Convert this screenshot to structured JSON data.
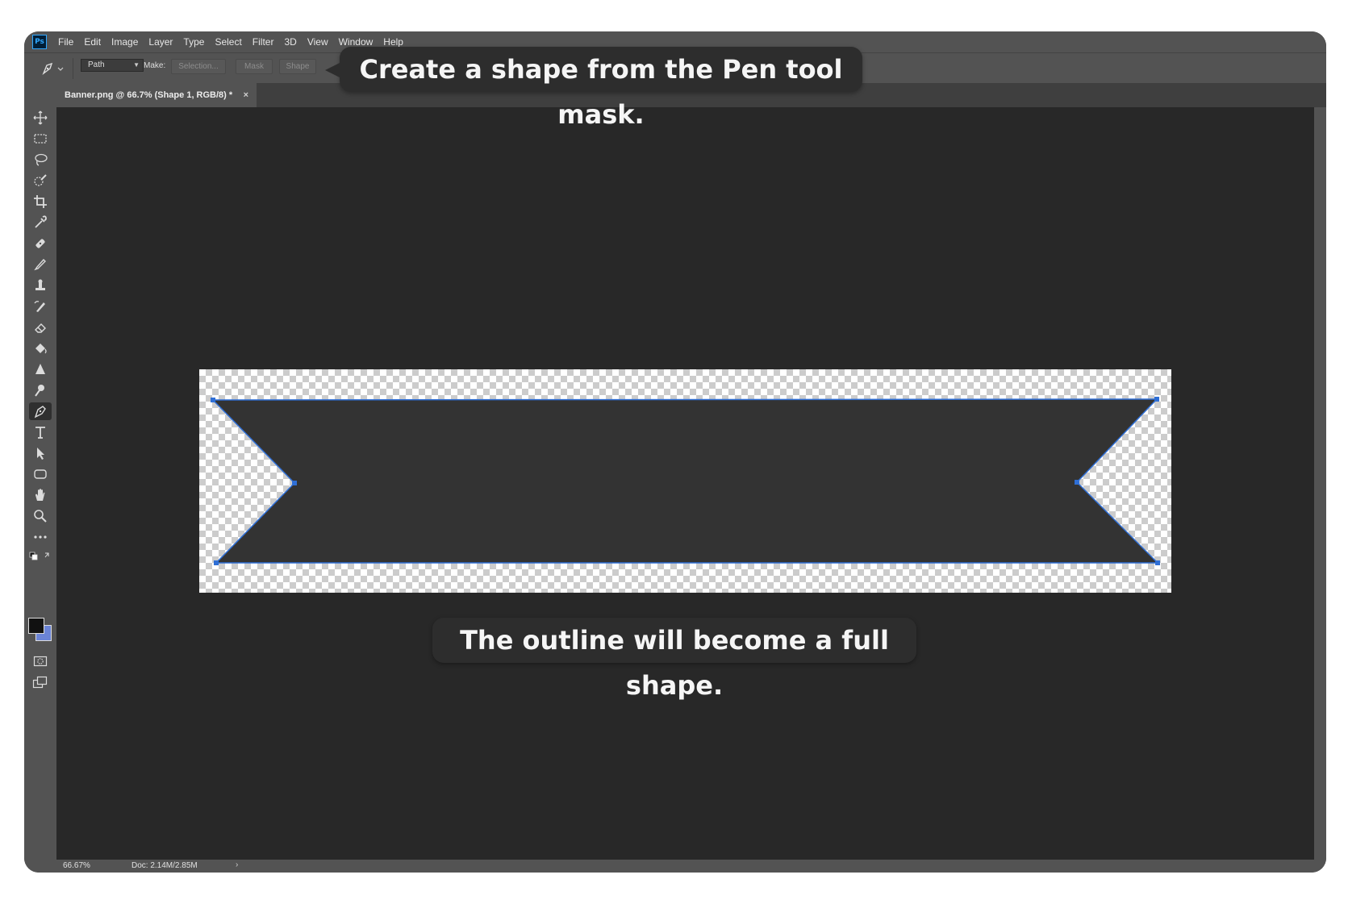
{
  "menubar": {
    "logo": "Ps",
    "items": [
      "File",
      "Edit",
      "Image",
      "Layer",
      "Type",
      "Select",
      "Filter",
      "3D",
      "View",
      "Window",
      "Help"
    ]
  },
  "options": {
    "mode_value": "Path",
    "make_label": "Make:",
    "selection_label": "Selection...",
    "mask_label": "Mask",
    "shape_label": "Shape"
  },
  "document_tab": {
    "title": "Banner.png @ 66.7% (Shape 1, RGB/8) *",
    "close": "×"
  },
  "tools": [
    "move-icon",
    "marquee-icon",
    "lasso-icon",
    "quick-selection-icon",
    "crop-icon",
    "eyedropper-icon",
    "healing-brush-icon",
    "brush-icon",
    "clone-stamp-icon",
    "history-brush-icon",
    "eraser-icon",
    "paint-bucket-icon",
    "blur-icon",
    "dodge-icon",
    "pen-icon",
    "type-icon",
    "path-selection-icon",
    "rectangle-icon",
    "hand-icon",
    "zoom-icon",
    "more-tools-icon"
  ],
  "active_tool": "pen-icon",
  "colors": {
    "foreground": "#111111",
    "background": "#6b84d6",
    "path": "#2f6fd6",
    "shape_fill": "#333333"
  },
  "status": {
    "zoom": "66.67%",
    "doc": "Doc: 2.14M/2.85M",
    "arrow": "›"
  },
  "callouts": {
    "top": "Create a shape from the Pen tool mask.",
    "bottom": "The outline will become a full shape."
  }
}
